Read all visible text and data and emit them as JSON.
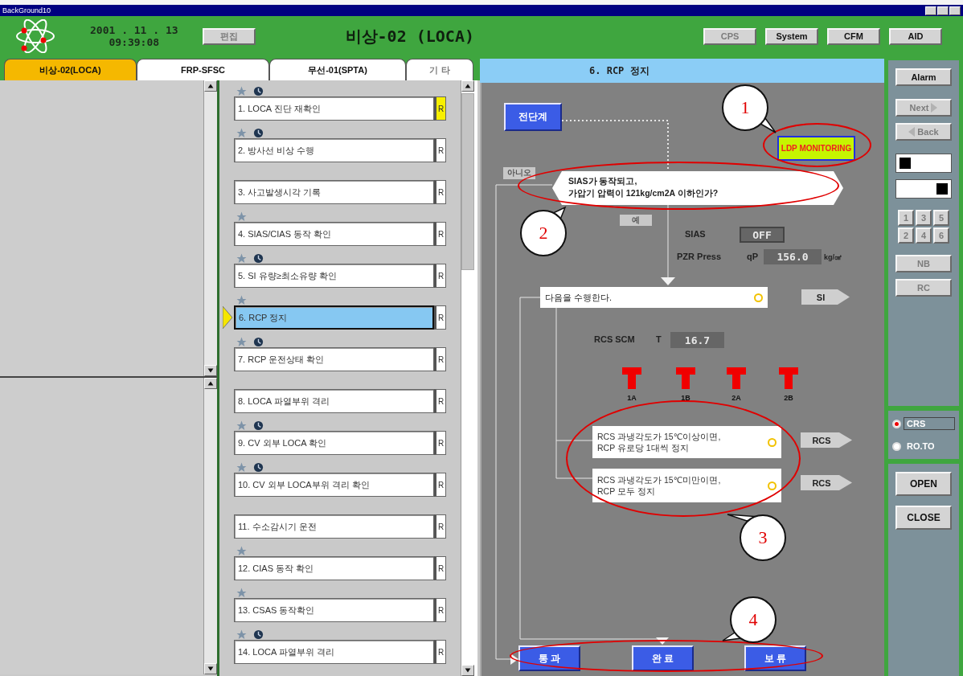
{
  "window": {
    "title": "BackGround10"
  },
  "header": {
    "date": "2001 . 11 . 13",
    "time": "09:39:08",
    "mode_button": {
      "label": "편집",
      "disabled": true
    },
    "title": "비상-02 (LOCA)",
    "buttons": [
      {
        "label": "CPS",
        "disabled": true
      },
      {
        "label": "System",
        "disabled": false
      },
      {
        "label": "CFM",
        "disabled": false
      },
      {
        "label": "AID",
        "disabled": false
      }
    ]
  },
  "tabs": [
    {
      "label": "비상-02(LOCA)",
      "selected": true,
      "disabled": false
    },
    {
      "label": "FRP-SFSC",
      "selected": false,
      "disabled": false
    },
    {
      "label": "무선-01(SPTA)",
      "selected": false,
      "disabled": false
    },
    {
      "label": "기 타",
      "selected": false,
      "disabled": true
    }
  ],
  "steps": [
    {
      "label": "1. LOCA 진단 재확인",
      "star": true,
      "clock": true,
      "selected": false,
      "flagged": true,
      "review": "R"
    },
    {
      "label": "2. 방사선 비상 수행",
      "star": true,
      "clock": true,
      "selected": false,
      "flagged": false,
      "review": "R"
    },
    {
      "label": "3. 사고발생시각 기록",
      "star": false,
      "clock": false,
      "selected": false,
      "flagged": false,
      "review": "R"
    },
    {
      "label": "4. SIAS/CIAS 동작 확인",
      "star": true,
      "clock": false,
      "selected": false,
      "flagged": false,
      "review": "R"
    },
    {
      "label": "5. SI 유량≥최소유량 확인",
      "star": true,
      "clock": true,
      "selected": false,
      "flagged": false,
      "review": "R"
    },
    {
      "label": "6. RCP 정지",
      "star": true,
      "clock": false,
      "selected": true,
      "flagged": false,
      "review": "R"
    },
    {
      "label": "7. RCP 운전상태 확인",
      "star": true,
      "clock": true,
      "selected": false,
      "flagged": false,
      "review": "R"
    },
    {
      "label": "8. LOCA 파열부위 격리",
      "star": false,
      "clock": false,
      "selected": false,
      "flagged": false,
      "review": "R"
    },
    {
      "label": "9. CV 외부 LOCA 확인",
      "star": true,
      "clock": true,
      "selected": false,
      "flagged": false,
      "review": "R"
    },
    {
      "label": "10. CV 외부 LOCA부위 격리 확인",
      "star": true,
      "clock": true,
      "selected": false,
      "flagged": false,
      "review": "R"
    },
    {
      "label": "11. 수소감시기 운전",
      "star": false,
      "clock": false,
      "selected": false,
      "flagged": false,
      "review": "R"
    },
    {
      "label": "12. CIAS 동작 확인",
      "star": true,
      "clock": false,
      "selected": false,
      "flagged": false,
      "review": "R"
    },
    {
      "label": "13. CSAS 동작확인",
      "star": true,
      "clock": false,
      "selected": false,
      "flagged": false,
      "review": "R"
    },
    {
      "label": "14. LOCA 파열부위 격리",
      "star": true,
      "clock": true,
      "selected": false,
      "flagged": false,
      "review": "R"
    }
  ],
  "flowchart": {
    "title": "6. RCP 정지",
    "prev_button": "전단계",
    "monitor": "LDP MONITORING",
    "no_label": "아니오",
    "decision": [
      "SIAS가 동작되고,",
      "가압기 압력이 121kg/cm2A 이하인가?"
    ],
    "yes_label": "예",
    "sias": {
      "label": "SIAS",
      "value": "OFF"
    },
    "pzr": {
      "label": "PZR Press",
      "symbol": "qP",
      "value": "156.0",
      "unit": "kg/㎠"
    },
    "action": {
      "text": "다음을 수행한다.",
      "button": "SI"
    },
    "scm": {
      "label": "RCS SCM",
      "symbol": "T",
      "value": "16.7"
    },
    "pumps": [
      {
        "name": "1A"
      },
      {
        "name": "1B"
      },
      {
        "name": "2A"
      },
      {
        "name": "2B"
      }
    ],
    "conditions": [
      {
        "lines": [
          "RCS 과냉각도가 15℃이상이면,",
          "RCP 유로당 1대씩 정지"
        ],
        "button": "RCS"
      },
      {
        "lines": [
          "RCS 과냉각도가 15℃미만이면,",
          "RCP 모두 정지"
        ],
        "button": "RCS"
      }
    ],
    "outcomes": [
      "통 과",
      "완 료",
      "보 류"
    ]
  },
  "sidebar": {
    "alarm": "Alarm",
    "next": {
      "label": "Next",
      "disabled": true
    },
    "back": {
      "label": "Back",
      "disabled": true
    },
    "keypad": [
      {
        "label": "1",
        "disabled": true
      },
      {
        "label": "3",
        "disabled": true
      },
      {
        "label": "5",
        "disabled": true
      },
      {
        "label": "2",
        "disabled": true
      },
      {
        "label": "4",
        "disabled": true
      },
      {
        "label": "6",
        "disabled": true
      }
    ],
    "extra_buttons": [
      {
        "label": "NB",
        "disabled": true
      },
      {
        "label": "RC",
        "disabled": true
      }
    ],
    "modes": [
      {
        "label": "CRS",
        "selected": true
      },
      {
        "label": "RO.TO",
        "selected": false
      }
    ],
    "open": "OPEN",
    "close": "CLOSE"
  },
  "annotations": [
    {
      "number": "1"
    },
    {
      "number": "2"
    },
    {
      "number": "3"
    },
    {
      "number": "4"
    }
  ]
}
